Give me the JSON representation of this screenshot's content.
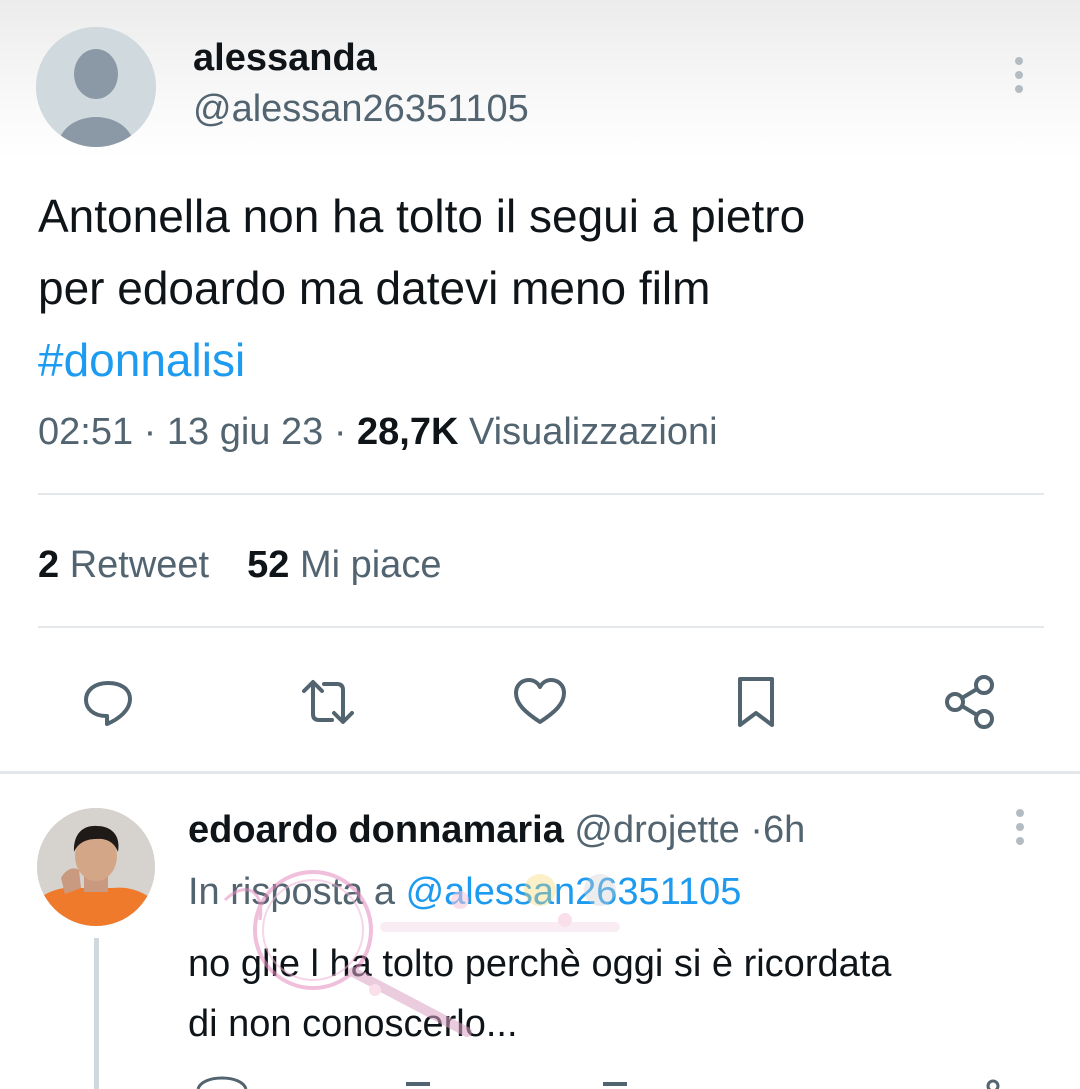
{
  "tweet": {
    "author": {
      "name": "alessanda",
      "handle": "@alessan26351105"
    },
    "text_lines": [
      "Antonella non ha tolto il segui a pietro",
      "per edoardo ma datevi meno film"
    ],
    "hashtag": "#donnalisi",
    "time": "02:51",
    "separator": "·",
    "date": "13 giu 23",
    "views_count": "28,7K",
    "views_label": "Visualizzazioni",
    "retweets_count": "2",
    "retweets_label": "Retweet",
    "likes_count": "52",
    "likes_label": "Mi piace",
    "actions": [
      "reply-icon",
      "retweet-icon",
      "like-icon",
      "bookmark-icon",
      "share-icon"
    ]
  },
  "reply": {
    "name": "edoardo donnamaria",
    "handle": "@drojette",
    "separator": "·",
    "age": "6h",
    "in_reply_prefix": "In risposta a",
    "in_reply_handle": "@alessan26351105",
    "text_lines": [
      "no glie l ha tolto perchè oggi si è ricordata",
      "di non conoscerlo..."
    ]
  },
  "colors": {
    "accent": "#1d9bf0",
    "secondary_text": "#536471",
    "primary_text": "#0f1419",
    "divider": "#e4e8eb"
  }
}
